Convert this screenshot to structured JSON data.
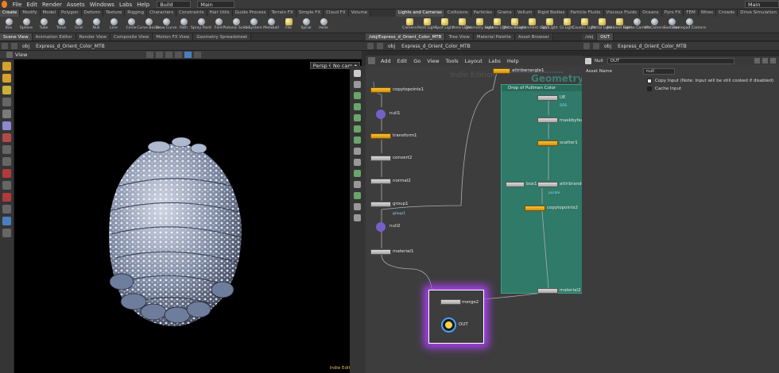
{
  "menubar": {
    "items": [
      "File",
      "Edit",
      "Render",
      "Assets",
      "Windows",
      "Labs",
      "Help"
    ],
    "desktop": "Build",
    "network_context": "Main",
    "right_context": "Main"
  },
  "shelf_left": {
    "tabs": [
      "Create",
      "Modify",
      "Model",
      "Polygon",
      "Deform",
      "Texture",
      "Rigging",
      "Characters",
      "Constraints",
      "Hair Utils",
      "Guide Process",
      "Terrain FX",
      "Simple FX",
      "Cloud FX",
      "Volume"
    ],
    "tools": [
      "Box",
      "Sphere",
      "Tube",
      "Torus",
      "Grid",
      "Null",
      "Line",
      "Circle",
      "Curve Bezier",
      "Draw Curve",
      "Path",
      "Spray Paint",
      "Font",
      "Platonic Solids",
      "L-System",
      "Metaball",
      "File",
      "Spiral",
      "Helix"
    ]
  },
  "shelf_right": {
    "tabs": [
      "Lights and Cameras",
      "Collisions",
      "Particles",
      "Grains",
      "Vellum",
      "Rigid Bodies",
      "Particle Fluids",
      "Viscous Fluids",
      "Oceans",
      "Pyro FX",
      "FEM",
      "Wires",
      "Crowds",
      "Drive Simulation"
    ],
    "tools": [
      "Camera",
      "Point Light",
      "Spot Light",
      "Area Light",
      "Geometry Light",
      "Volume Light",
      "Distant Light",
      "Environment Light",
      "Sky Light",
      "GI Light",
      "Caustic Light",
      "Portal Light",
      "Ambient Light",
      "Stereo Camera",
      "VR Camera",
      "Switcher",
      "Gamepad Camera"
    ]
  },
  "left_panetabs": [
    "Scene View",
    "Animation Editor",
    "Render View",
    "Composite View",
    "Motion FX View",
    "Geometry Spreadsheet"
  ],
  "mid_panetabs": [
    "/obj/Express_d_Orient_Color_MTB",
    "Tree View",
    "Material Palette",
    "Asset Browser"
  ],
  "right_panetabs": [
    "/obj",
    "OUT"
  ],
  "viewport": {
    "path_obj": "obj",
    "path_node": "Express_d_Orient_Color_MTB",
    "title": "View",
    "persp": "Persp",
    "cam": "No cam",
    "badge": "Indie Edition"
  },
  "network": {
    "path_obj": "obj",
    "path_node": "Express_d_Orient_Color_MTB",
    "menu": [
      "Add",
      "Edit",
      "Go",
      "View",
      "Tools",
      "Layout",
      "Labs",
      "Help"
    ],
    "watermark_indie": "Indie Edition",
    "watermark_geo": "Geometry",
    "netbox_title": "Drop of Pullman Color",
    "nodes": {
      "copytopoints1": "copytopoints1",
      "null1": "null1",
      "transform1": "transform1",
      "convert2": "convert2",
      "normal2": "normal2",
      "group1": "group1",
      "group1_sub": "group1",
      "null2": "null2",
      "material1": "material1",
      "attribwrangle1": "attribwrangle1",
      "uv": "UE",
      "uv_sub": "SOS",
      "maskbyfeature": "maskbyfeat",
      "scatter1": "scatter1",
      "box1": "box1",
      "attribrandom": "attribrando",
      "attribrandom_sub": "pscale",
      "copytopoints2": "copytopoints2",
      "material2": "material2",
      "merge2": "merge2",
      "out": "OUT"
    }
  },
  "params": {
    "path_obj": "obj",
    "path_node": "Express_d_Orient_Color_MTB",
    "node_type": "Null",
    "node_name": "OUT",
    "asset_name_label": "Asset Name",
    "asset_name_value": "null",
    "copy_input": "Copy Input (Note: Input will be still cooked if disabled)",
    "cache_input": "Cache Input"
  },
  "colors": {
    "accent_orange": "#f0b030",
    "netbox_teal": "#2f7a68",
    "selection_purple": "#b040ff",
    "bg_dark": "#2b2b2b"
  }
}
